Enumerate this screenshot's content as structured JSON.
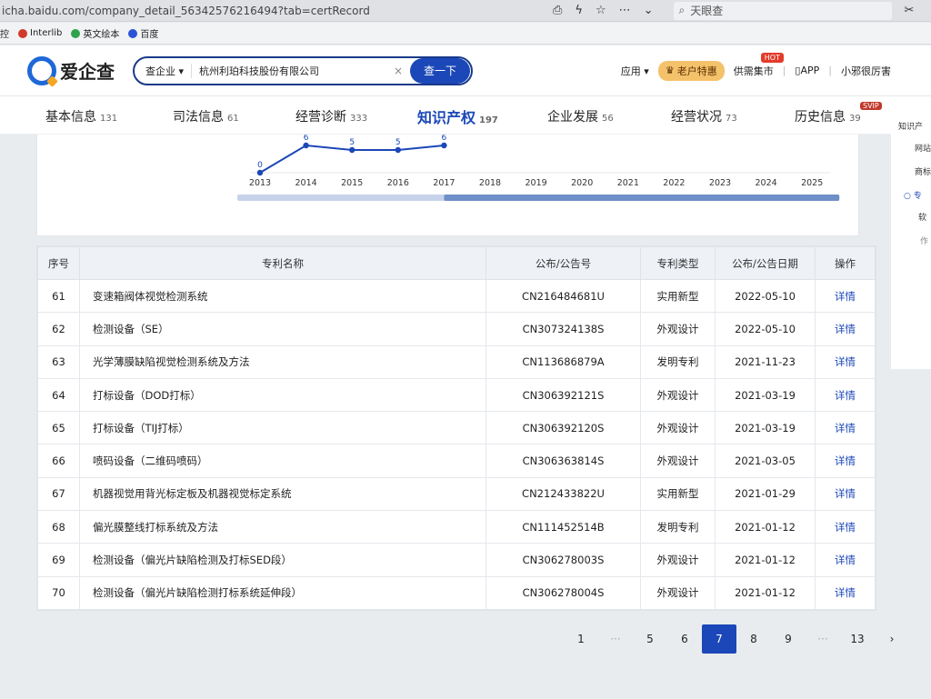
{
  "browser": {
    "url": "icha.baidu.com/company_detail_56342576216494?tab=certRecord",
    "search_placeholder": "天眼查",
    "bookmarks": [
      {
        "label": "控"
      },
      {
        "label": "Interlib"
      },
      {
        "label": "英文绘本"
      },
      {
        "label": "百度"
      }
    ]
  },
  "header": {
    "logo_text": "爱企查",
    "search_category": "查企业 ▾",
    "search_value": "杭州利珀科技股份有限公司",
    "search_button": "查一下",
    "nav": {
      "apps": "应用 ▾",
      "vip": "老户特惠",
      "supply": "供需集市",
      "hot": "HOT",
      "app": "APP",
      "user": "小邪很厉害"
    }
  },
  "tabs": [
    {
      "label": "基本信息",
      "count": "131"
    },
    {
      "label": "司法信息",
      "count": "61"
    },
    {
      "label": "经营诊断",
      "count": "333"
    },
    {
      "label": "知识产权",
      "count": "197"
    },
    {
      "label": "企业发展",
      "count": "56"
    },
    {
      "label": "经营状况",
      "count": "73"
    },
    {
      "label": "历史信息",
      "count": "39"
    }
  ],
  "svip_badge": "SVIP",
  "side_panel": {
    "items": [
      "知识产",
      "网站",
      "商标",
      "专",
      "软",
      "作"
    ]
  },
  "chart_data": {
    "type": "line",
    "x": [
      "2013",
      "2014",
      "2015",
      "2016",
      "2017",
      "2018",
      "2019",
      "2020",
      "2021",
      "2022",
      "2023",
      "2024",
      "2025"
    ],
    "visible_labels": [
      "0",
      "6",
      "5",
      "5",
      "6"
    ],
    "series": [
      {
        "values": [
          0,
          6,
          5,
          5,
          6
        ]
      }
    ],
    "color": "#1b47b8"
  },
  "table": {
    "headers": [
      "序号",
      "专利名称",
      "公布/公告号",
      "专利类型",
      "公布/公告日期",
      "操作"
    ],
    "rows": [
      {
        "num": "61",
        "name": "变速箱阀体视觉检测系统",
        "code": "CN216484681U",
        "type": "实用新型",
        "date": "2022-05-10",
        "op": "详情"
      },
      {
        "num": "62",
        "name": "检测设备（SE）",
        "code": "CN307324138S",
        "type": "外观设计",
        "date": "2022-05-10",
        "op": "详情"
      },
      {
        "num": "63",
        "name": "光学薄膜缺陷视觉检测系统及方法",
        "code": "CN113686879A",
        "type": "发明专利",
        "date": "2021-11-23",
        "op": "详情"
      },
      {
        "num": "64",
        "name": "打标设备（DOD打标）",
        "code": "CN306392121S",
        "type": "外观设计",
        "date": "2021-03-19",
        "op": "详情"
      },
      {
        "num": "65",
        "name": "打标设备（TIJ打标）",
        "code": "CN306392120S",
        "type": "外观设计",
        "date": "2021-03-19",
        "op": "详情"
      },
      {
        "num": "66",
        "name": "喷码设备（二维码喷码）",
        "code": "CN306363814S",
        "type": "外观设计",
        "date": "2021-03-05",
        "op": "详情"
      },
      {
        "num": "67",
        "name": "机器视觉用背光标定板及机器视觉标定系统",
        "code": "CN212433822U",
        "type": "实用新型",
        "date": "2021-01-29",
        "op": "详情"
      },
      {
        "num": "68",
        "name": "偏光膜整线打标系统及方法",
        "code": "CN111452514B",
        "type": "发明专利",
        "date": "2021-01-12",
        "op": "详情"
      },
      {
        "num": "69",
        "name": "检测设备（偏光片缺陷检测及打标SED段）",
        "code": "CN306278003S",
        "type": "外观设计",
        "date": "2021-01-12",
        "op": "详情"
      },
      {
        "num": "70",
        "name": "检测设备（偏光片缺陷检测打标系统延伸段）",
        "code": "CN306278004S",
        "type": "外观设计",
        "date": "2021-01-12",
        "op": "详情"
      }
    ]
  },
  "pagination": {
    "items": [
      "1",
      "···",
      "5",
      "6",
      "7",
      "8",
      "9",
      "···",
      "13",
      "›"
    ],
    "active": "7"
  }
}
